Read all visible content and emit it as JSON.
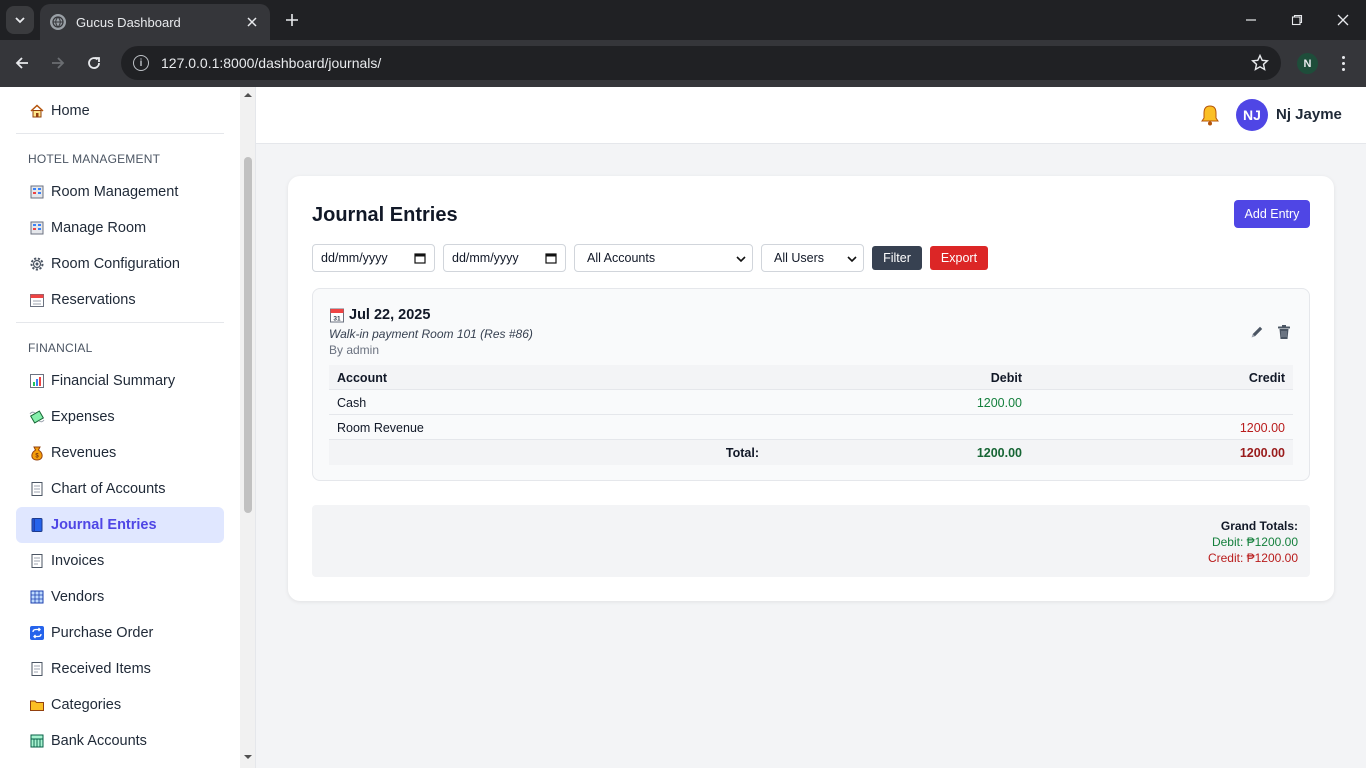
{
  "browser": {
    "tab_title": "Gucus Dashboard",
    "url": "127.0.0.1:8000/dashboard/journals/",
    "profile_initial": "N"
  },
  "sidebar": {
    "home": {
      "label": "Home",
      "icon": "house-icon"
    },
    "sections": [
      {
        "title": "HOTEL MANAGEMENT"
      },
      {
        "title": "FINANCIAL"
      }
    ],
    "items": [
      {
        "label": "Room Management",
        "icon": "hotel-icon"
      },
      {
        "label": "Manage Room",
        "icon": "hotel-icon"
      },
      {
        "label": "Room Configuration",
        "icon": "gear-icon"
      },
      {
        "label": "Reservations",
        "icon": "calendar-icon"
      },
      {
        "label": "Financial Summary",
        "icon": "bar-chart-icon"
      },
      {
        "label": "Expenses",
        "icon": "money-wings-icon"
      },
      {
        "label": "Revenues",
        "icon": "money-bag-icon"
      },
      {
        "label": "Chart of Accounts",
        "icon": "ledger-icon"
      },
      {
        "label": "Journal Entries",
        "icon": "book-icon",
        "active": true
      },
      {
        "label": "Invoices",
        "icon": "document-icon"
      },
      {
        "label": "Vendors",
        "icon": "building-icon"
      },
      {
        "label": "Purchase Order",
        "icon": "repeat-icon"
      },
      {
        "label": "Received Items",
        "icon": "document-icon"
      },
      {
        "label": "Categories",
        "icon": "folder-icon"
      },
      {
        "label": "Bank Accounts",
        "icon": "bank-icon"
      }
    ]
  },
  "header": {
    "avatar_initials": "NJ",
    "user_name": "Nj Jayme"
  },
  "main": {
    "title": "Journal Entries",
    "add_button": "Add Entry",
    "filters": {
      "date_from_placeholder": "dd/mm/yyyy",
      "date_to_placeholder": "dd/mm/yyyy",
      "account_select": "All Accounts",
      "user_select": "All Users",
      "filter_button": "Filter",
      "export_button": "Export"
    },
    "entries": [
      {
        "date": "Jul 22, 2025",
        "description": "Walk-in payment Room 101 (Res #86)",
        "by": "By admin",
        "columns": [
          "Account",
          "Debit",
          "Credit"
        ],
        "rows": [
          {
            "account": "Cash",
            "debit": "1200.00",
            "credit": ""
          },
          {
            "account": "Room Revenue",
            "debit": "",
            "credit": "1200.00"
          }
        ],
        "total_label": "Total:",
        "total_debit": "1200.00",
        "total_credit": "1200.00"
      }
    ],
    "grand_totals": {
      "title": "Grand Totals:",
      "debit": "Debit: ₱1200.00",
      "credit": "Credit: ₱1200.00"
    }
  },
  "colors": {
    "accent": "#4f46e5",
    "debit_green": "#15803d",
    "credit_red": "#b91c1c",
    "export_red": "#dc2626"
  }
}
